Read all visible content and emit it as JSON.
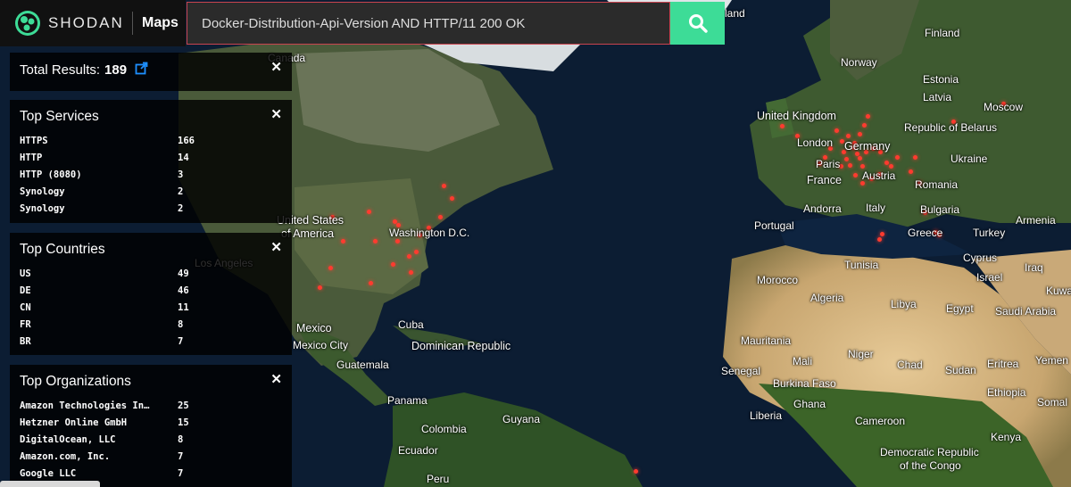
{
  "brand": {
    "name": "SHODAN",
    "section": "Maps"
  },
  "search": {
    "value": "Docker-Distribution-Api-Version AND HTTP/11 200 OK",
    "button_icon": "search-icon"
  },
  "colors": {
    "accent": "#3ddc97",
    "marker": "#ff3b2f",
    "search_border": "#c9444f"
  },
  "total": {
    "label": "Total Results:",
    "value": "189",
    "icon": "external-link-icon"
  },
  "panels": [
    {
      "title": "Top Services",
      "rows": [
        {
          "k": "HTTPS",
          "v": "166"
        },
        {
          "k": "HTTP",
          "v": "14"
        },
        {
          "k": "HTTP (8080)",
          "v": "3"
        },
        {
          "k": "Synology",
          "v": "2"
        },
        {
          "k": "Synology",
          "v": "2"
        }
      ]
    },
    {
      "title": "Top Countries",
      "rows": [
        {
          "k": "US",
          "v": "49"
        },
        {
          "k": "DE",
          "v": "46"
        },
        {
          "k": "CN",
          "v": "11"
        },
        {
          "k": "FR",
          "v": "8"
        },
        {
          "k": "BR",
          "v": "7"
        }
      ]
    },
    {
      "title": "Top Organizations",
      "rows": [
        {
          "k": "Amazon Technologies In…",
          "v": "25"
        },
        {
          "k": "Hetzner Online GmbH",
          "v": "15"
        },
        {
          "k": "DigitalOcean, LLC",
          "v": "8"
        },
        {
          "k": "Amazon.com, Inc.",
          "v": "7"
        },
        {
          "k": "Google LLC",
          "v": "7"
        }
      ]
    }
  ],
  "close_symbol": "✕",
  "map_labels": {
    "canada": "Canada",
    "finland": "Finland",
    "norway": "Norway",
    "estonia": "Estonia",
    "latvia": "Latvia",
    "moscow": "Moscow",
    "uk": "United Kingdom",
    "london": "London",
    "germany": "Germany",
    "belarus": "Republic of Belarus",
    "paris": "Paris",
    "ukraine": "Ukraine",
    "france": "France",
    "austria": "Austria",
    "romania": "Romania",
    "andorra": "Andorra",
    "italy": "Italy",
    "bulgaria": "Bulgaria",
    "armenia": "Armenia",
    "portugal": "Portugal",
    "greece": "Greece",
    "turkey": "Turkey",
    "cyprus": "Cyprus",
    "iraq": "Iraq",
    "tunisia": "Tunisia",
    "israel": "Israel",
    "kuwait": "Kuwait",
    "morocco": "Morocco",
    "algeria": "Algeria",
    "libya": "Libya",
    "egypt": "Egypt",
    "saudi": "Saudi Arabia",
    "us1": "United States",
    "us2": "of America",
    "dc": "Washington D.C.",
    "la": "Los Angeles",
    "mexico": "Mexico",
    "mexicocity": "Mexico City",
    "cuba": "Cuba",
    "dr": "Dominican Republic",
    "guatemala": "Guatemala",
    "panama": "Panama",
    "colombia": "Colombia",
    "guyana": "Guyana",
    "ecuador": "Ecuador",
    "peru": "Peru",
    "mauritania": "Mauritania",
    "mali": "Mali",
    "niger": "Niger",
    "chad": "Chad",
    "sudan": "Sudan",
    "eritrea": "Eritrea",
    "yemen": "Yemen",
    "senegal": "Senegal",
    "burkina": "Burkina Faso",
    "ghana": "Ghana",
    "liberia": "Liberia",
    "ethiopia": "Ethiopia",
    "somalia": "Somal",
    "cameroon": "Cameroon",
    "kenya": "Kenya",
    "drc1": "Democratic Republic",
    "drc2": "of the Congo",
    "iceland": "land"
  }
}
